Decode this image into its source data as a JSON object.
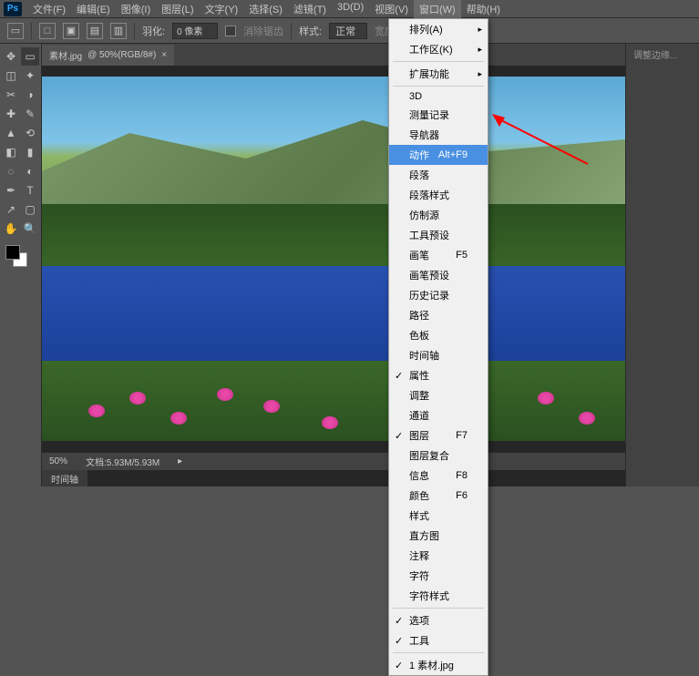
{
  "app_logo": "Ps",
  "menubar": [
    "文件(F)",
    "编辑(E)",
    "图像(I)",
    "图层(L)",
    "文字(Y)",
    "选择(S)",
    "滤镜(T)",
    "3D(D)",
    "视图(V)",
    "窗口(W)",
    "帮助(H)"
  ],
  "active_menu_index": 9,
  "options_bar": {
    "feather_label": "羽化:",
    "feather_value": "0 像素",
    "antialias": "消除锯齿",
    "style_label": "样式:",
    "style_value": "正常",
    "width_label": "宽度:",
    "adjust_edge": "调整边缘..."
  },
  "document_tab": {
    "name": "素材.jpg",
    "info": "@ 50%(RGB/8#)"
  },
  "window_menu": {
    "groups": [
      [
        {
          "label": "排列(A)",
          "sub": true
        },
        {
          "label": "工作区(K)",
          "sub": true
        }
      ],
      [
        {
          "label": "扩展功能",
          "sub": true
        }
      ],
      [
        {
          "label": "3D"
        },
        {
          "label": "测量记录"
        },
        {
          "label": "导航器"
        },
        {
          "label": "动作",
          "shortcut": "Alt+F9",
          "highlighted": true
        },
        {
          "label": "段落"
        },
        {
          "label": "段落样式"
        },
        {
          "label": "仿制源"
        },
        {
          "label": "工具预设"
        },
        {
          "label": "画笔",
          "shortcut": "F5"
        },
        {
          "label": "画笔预设"
        },
        {
          "label": "历史记录"
        },
        {
          "label": "路径"
        },
        {
          "label": "色板"
        },
        {
          "label": "时间轴"
        },
        {
          "label": "属性",
          "checked": true
        },
        {
          "label": "调整"
        },
        {
          "label": "通道"
        },
        {
          "label": "图层",
          "shortcut": "F7",
          "checked": true
        },
        {
          "label": "图层复合"
        },
        {
          "label": "信息",
          "shortcut": "F8"
        },
        {
          "label": "颜色",
          "shortcut": "F6"
        },
        {
          "label": "样式"
        },
        {
          "label": "直方图"
        },
        {
          "label": "注释"
        },
        {
          "label": "字符"
        },
        {
          "label": "字符样式"
        }
      ],
      [
        {
          "label": "选项",
          "checked": true
        },
        {
          "label": "工具",
          "checked": true
        }
      ],
      [
        {
          "label": "1 素材.jpg",
          "checked": true
        }
      ]
    ]
  },
  "status": {
    "zoom": "50%",
    "doc_label": "文档:",
    "doc_size": "5.93M/5.93M"
  },
  "bottom_tab": "时间轴",
  "tools": [
    "move",
    "marquee",
    "lasso",
    "wand",
    "crop",
    "eyedropper",
    "heal",
    "brush",
    "stamp",
    "history",
    "eraser",
    "gradient",
    "blur",
    "dodge",
    "pen",
    "type",
    "path",
    "shape",
    "hand",
    "zoom"
  ]
}
